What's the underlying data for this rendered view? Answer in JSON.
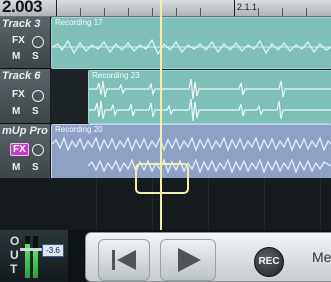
{
  "ruler": {
    "position": "2.003",
    "bar_label": "2.1.1"
  },
  "tracks": [
    {
      "name": "Track 3",
      "fx_label": "FX",
      "fx_active": false,
      "mute_label": "M",
      "solo_label": "S",
      "clip_name": "Recording 17",
      "clip_color": "#7ec0b8"
    },
    {
      "name": "Track 6",
      "fx_label": "FX",
      "fx_active": false,
      "mute_label": "M",
      "solo_label": "S",
      "clip_name": "Recording 23",
      "clip_color": "#7ec0b8"
    },
    {
      "name": "mUp Pro",
      "fx_label": "FX",
      "fx_active": true,
      "mute_label": "M",
      "solo_label": "S",
      "clip_name": "Recording 20",
      "clip_color": "#8ea0c4"
    }
  ],
  "meter": {
    "label_letters": [
      "O",
      "U",
      "T"
    ],
    "volume": "-3.6"
  },
  "transport": {
    "rec_label": "REC",
    "menu_label": "Menu"
  }
}
